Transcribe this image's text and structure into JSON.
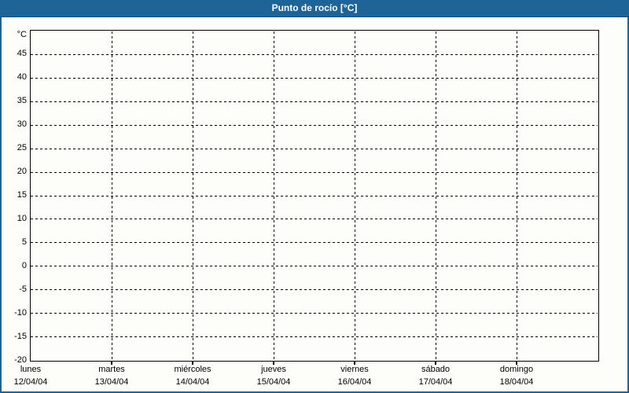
{
  "window": {
    "title": "Punto de rocío [°C]"
  },
  "colors": {
    "titlebar_bg": "#1e6496",
    "titlebar_border": "#16507c",
    "titlebar_text": "#ffffff",
    "window_border": "#1e6496",
    "background": "#fdfefa",
    "axis": "#000000",
    "gridline": "#000000",
    "text": "#000000"
  },
  "chart_data": {
    "type": "line",
    "title": "Punto de rocío [°C]",
    "ylabel": "°C",
    "ylim": [
      -20,
      50
    ],
    "y_ticks": [
      45,
      40,
      35,
      30,
      25,
      20,
      15,
      10,
      5,
      0,
      -5,
      -10,
      -15,
      -20
    ],
    "grid": "dashed",
    "legend": "none",
    "x_axis": {
      "days": [
        {
          "name": "lunes",
          "date": "12/04/04"
        },
        {
          "name": "martes",
          "date": "13/04/04"
        },
        {
          "name": "miércoles",
          "date": "14/04/04"
        },
        {
          "name": "jueves",
          "date": "15/04/04"
        },
        {
          "name": "viernes",
          "date": "16/04/04"
        },
        {
          "name": "sábado",
          "date": "17/04/04"
        },
        {
          "name": "domingo",
          "date": "18/04/04"
        }
      ]
    },
    "series": []
  }
}
